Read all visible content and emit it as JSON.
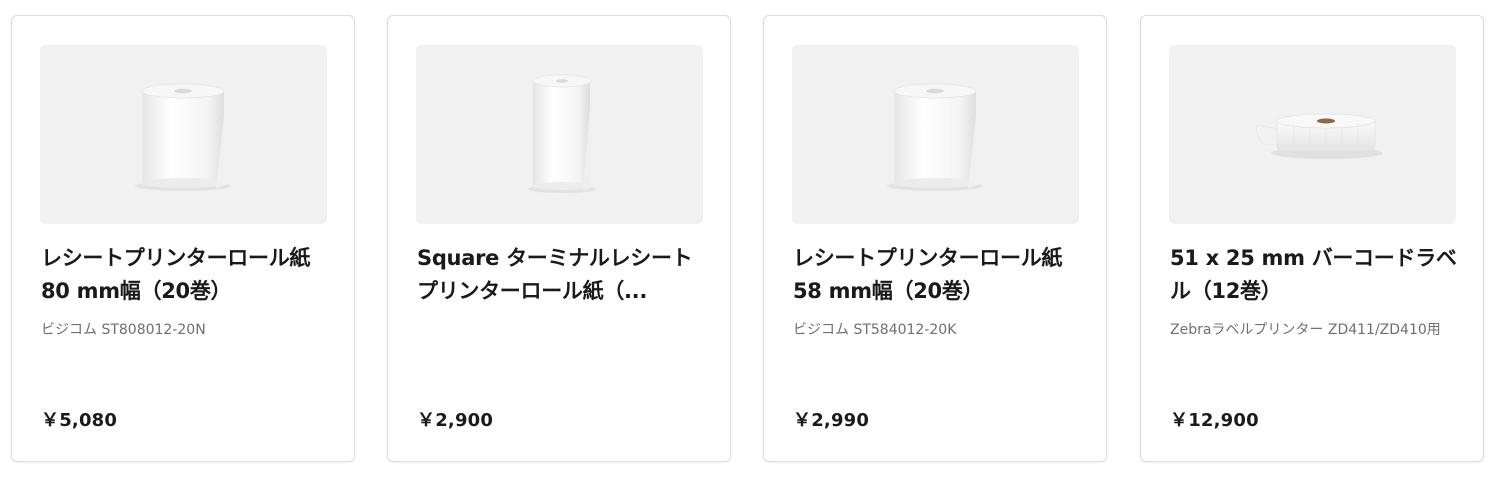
{
  "products": [
    {
      "title": "レシートプリンターロール紙 80 mm幅（20巻）",
      "subtitle": "ビジコム ST808012-20N",
      "price": "￥5,080",
      "image_icon": "receipt-paper-roll-wide-icon"
    },
    {
      "title": "Square ターミナルレシートプリンターロール紙（...",
      "subtitle": "",
      "price": "￥2,900",
      "image_icon": "receipt-paper-roll-narrow-icon"
    },
    {
      "title": "レシートプリンターロール紙 58 mm幅（20巻）",
      "subtitle": "ビジコム ST584012-20K",
      "price": "￥2,990",
      "image_icon": "receipt-paper-roll-wide-icon"
    },
    {
      "title": "51 x 25 mm バーコードラベル（12巻）",
      "subtitle": "Zebraラベルプリンター ZD411/ZD410用",
      "price": "￥12,900",
      "image_icon": "barcode-label-roll-icon"
    }
  ],
  "colors": {
    "card_border": "#dcdcdc",
    "thumb_bg": "#f1f1f1",
    "title_text": "#1a1a1a",
    "subtitle_text": "#6f6f6f"
  }
}
